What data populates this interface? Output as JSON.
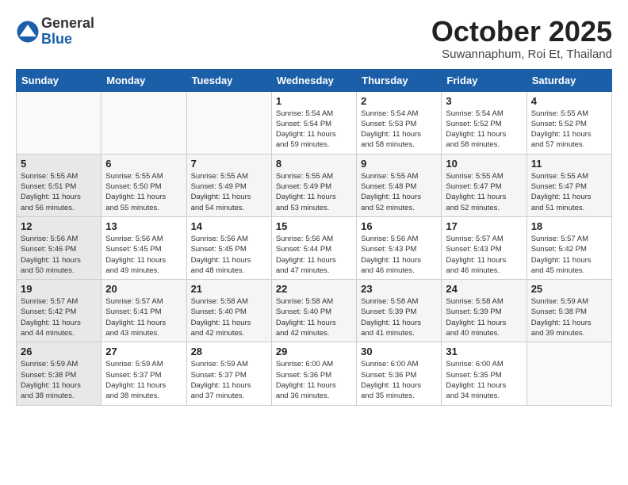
{
  "header": {
    "logo_general": "General",
    "logo_blue": "Blue",
    "month_title": "October 2025",
    "location": "Suwannaphum, Roi Et, Thailand"
  },
  "days_of_week": [
    "Sunday",
    "Monday",
    "Tuesday",
    "Wednesday",
    "Thursday",
    "Friday",
    "Saturday"
  ],
  "weeks": [
    [
      {
        "day": "",
        "info": ""
      },
      {
        "day": "",
        "info": ""
      },
      {
        "day": "",
        "info": ""
      },
      {
        "day": "1",
        "info": "Sunrise: 5:54 AM\nSunset: 5:54 PM\nDaylight: 11 hours\nand 59 minutes."
      },
      {
        "day": "2",
        "info": "Sunrise: 5:54 AM\nSunset: 5:53 PM\nDaylight: 11 hours\nand 58 minutes."
      },
      {
        "day": "3",
        "info": "Sunrise: 5:54 AM\nSunset: 5:52 PM\nDaylight: 11 hours\nand 58 minutes."
      },
      {
        "day": "4",
        "info": "Sunrise: 5:55 AM\nSunset: 5:52 PM\nDaylight: 11 hours\nand 57 minutes."
      }
    ],
    [
      {
        "day": "5",
        "info": "Sunrise: 5:55 AM\nSunset: 5:51 PM\nDaylight: 11 hours\nand 56 minutes."
      },
      {
        "day": "6",
        "info": "Sunrise: 5:55 AM\nSunset: 5:50 PM\nDaylight: 11 hours\nand 55 minutes."
      },
      {
        "day": "7",
        "info": "Sunrise: 5:55 AM\nSunset: 5:49 PM\nDaylight: 11 hours\nand 54 minutes."
      },
      {
        "day": "8",
        "info": "Sunrise: 5:55 AM\nSunset: 5:49 PM\nDaylight: 11 hours\nand 53 minutes."
      },
      {
        "day": "9",
        "info": "Sunrise: 5:55 AM\nSunset: 5:48 PM\nDaylight: 11 hours\nand 52 minutes."
      },
      {
        "day": "10",
        "info": "Sunrise: 5:55 AM\nSunset: 5:47 PM\nDaylight: 11 hours\nand 52 minutes."
      },
      {
        "day": "11",
        "info": "Sunrise: 5:55 AM\nSunset: 5:47 PM\nDaylight: 11 hours\nand 51 minutes."
      }
    ],
    [
      {
        "day": "12",
        "info": "Sunrise: 5:56 AM\nSunset: 5:46 PM\nDaylight: 11 hours\nand 50 minutes."
      },
      {
        "day": "13",
        "info": "Sunrise: 5:56 AM\nSunset: 5:45 PM\nDaylight: 11 hours\nand 49 minutes."
      },
      {
        "day": "14",
        "info": "Sunrise: 5:56 AM\nSunset: 5:45 PM\nDaylight: 11 hours\nand 48 minutes."
      },
      {
        "day": "15",
        "info": "Sunrise: 5:56 AM\nSunset: 5:44 PM\nDaylight: 11 hours\nand 47 minutes."
      },
      {
        "day": "16",
        "info": "Sunrise: 5:56 AM\nSunset: 5:43 PM\nDaylight: 11 hours\nand 46 minutes."
      },
      {
        "day": "17",
        "info": "Sunrise: 5:57 AM\nSunset: 5:43 PM\nDaylight: 11 hours\nand 46 minutes."
      },
      {
        "day": "18",
        "info": "Sunrise: 5:57 AM\nSunset: 5:42 PM\nDaylight: 11 hours\nand 45 minutes."
      }
    ],
    [
      {
        "day": "19",
        "info": "Sunrise: 5:57 AM\nSunset: 5:42 PM\nDaylight: 11 hours\nand 44 minutes."
      },
      {
        "day": "20",
        "info": "Sunrise: 5:57 AM\nSunset: 5:41 PM\nDaylight: 11 hours\nand 43 minutes."
      },
      {
        "day": "21",
        "info": "Sunrise: 5:58 AM\nSunset: 5:40 PM\nDaylight: 11 hours\nand 42 minutes."
      },
      {
        "day": "22",
        "info": "Sunrise: 5:58 AM\nSunset: 5:40 PM\nDaylight: 11 hours\nand 42 minutes."
      },
      {
        "day": "23",
        "info": "Sunrise: 5:58 AM\nSunset: 5:39 PM\nDaylight: 11 hours\nand 41 minutes."
      },
      {
        "day": "24",
        "info": "Sunrise: 5:58 AM\nSunset: 5:39 PM\nDaylight: 11 hours\nand 40 minutes."
      },
      {
        "day": "25",
        "info": "Sunrise: 5:59 AM\nSunset: 5:38 PM\nDaylight: 11 hours\nand 39 minutes."
      }
    ],
    [
      {
        "day": "26",
        "info": "Sunrise: 5:59 AM\nSunset: 5:38 PM\nDaylight: 11 hours\nand 38 minutes."
      },
      {
        "day": "27",
        "info": "Sunrise: 5:59 AM\nSunset: 5:37 PM\nDaylight: 11 hours\nand 38 minutes."
      },
      {
        "day": "28",
        "info": "Sunrise: 5:59 AM\nSunset: 5:37 PM\nDaylight: 11 hours\nand 37 minutes."
      },
      {
        "day": "29",
        "info": "Sunrise: 6:00 AM\nSunset: 5:36 PM\nDaylight: 11 hours\nand 36 minutes."
      },
      {
        "day": "30",
        "info": "Sunrise: 6:00 AM\nSunset: 5:36 PM\nDaylight: 11 hours\nand 35 minutes."
      },
      {
        "day": "31",
        "info": "Sunrise: 6:00 AM\nSunset: 5:35 PM\nDaylight: 11 hours\nand 34 minutes."
      },
      {
        "day": "",
        "info": ""
      }
    ]
  ]
}
